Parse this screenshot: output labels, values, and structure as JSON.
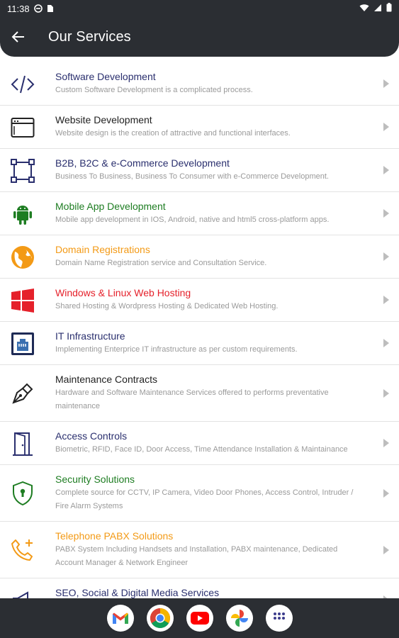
{
  "status_bar": {
    "time": "11:38"
  },
  "app_bar": {
    "title": "Our Services"
  },
  "colors": {
    "navy": "#2a2f6e",
    "green": "#1e7d22",
    "orange": "#f39a16",
    "red": "#e5212b",
    "dark": "#222222"
  },
  "services": [
    {
      "title": "Software Development",
      "description": "Custom Software Development is a complicated process.",
      "color": "#2a2f6e",
      "icon": "code-icon"
    },
    {
      "title": "Website Development",
      "description": "Website design is the creation of attractive and functional interfaces.",
      "color": "#222222",
      "icon": "browser-window-icon"
    },
    {
      "title": "B2B, B2C & e-Commerce Development",
      "description": "Business To Business, Business To Consumer with e-Commerce Development.",
      "color": "#2a2f6e",
      "icon": "selection-square-icon"
    },
    {
      "title": "Mobile App Development",
      "description": "Mobile app development in IOS, Android, native and html5 cross-platform apps.",
      "color": "#1e7d22",
      "icon": "android-icon"
    },
    {
      "title": "Domain Registrations",
      "description": "Domain Name Registration service and Consultation Service.",
      "color": "#f39a16",
      "icon": "globe-icon"
    },
    {
      "title": "Windows & Linux Web Hosting",
      "description": "Shared Hosting & Wordpress Hosting & Dedicated Web Hosting.",
      "color": "#e5212b",
      "icon": "windows-icon"
    },
    {
      "title": "IT Infrastructure",
      "description": "Implementing Enterprice IT infrastructure as per custom requirements.",
      "color": "#2a2f6e",
      "icon": "network-port-icon"
    },
    {
      "title": "Maintenance Contracts",
      "description": "Hardware and Software Maintenance Services offered to performs preventative maintenance",
      "color": "#222222",
      "icon": "pen-nib-icon"
    },
    {
      "title": "Access Controls",
      "description": "Biometric, RFID, Face ID, Door Access, Time Attendance Installation & Maintainance",
      "color": "#2a2f6e",
      "icon": "door-icon"
    },
    {
      "title": "Security Solutions",
      "description": "Complete source for CCTV, IP Camera, Video Door Phones, Access Control, Intruder / Fire Alarm Systems",
      "color": "#1e7d22",
      "icon": "shield-lock-icon"
    },
    {
      "title": "Telephone PABX Solutions",
      "description": "PABX System Including Handsets and Installation, PABX maintenance, Dedicated Account Manager & Network Engineer",
      "color": "#f39a16",
      "icon": "phone-add-icon"
    },
    {
      "title": "SEO, Social & Digital Media Services",
      "description": "",
      "color": "#2a2f6e",
      "icon": "megaphone-icon"
    }
  ],
  "dock": [
    "gmail-icon",
    "chrome-icon",
    "youtube-icon",
    "photos-icon",
    "app-drawer-icon"
  ]
}
